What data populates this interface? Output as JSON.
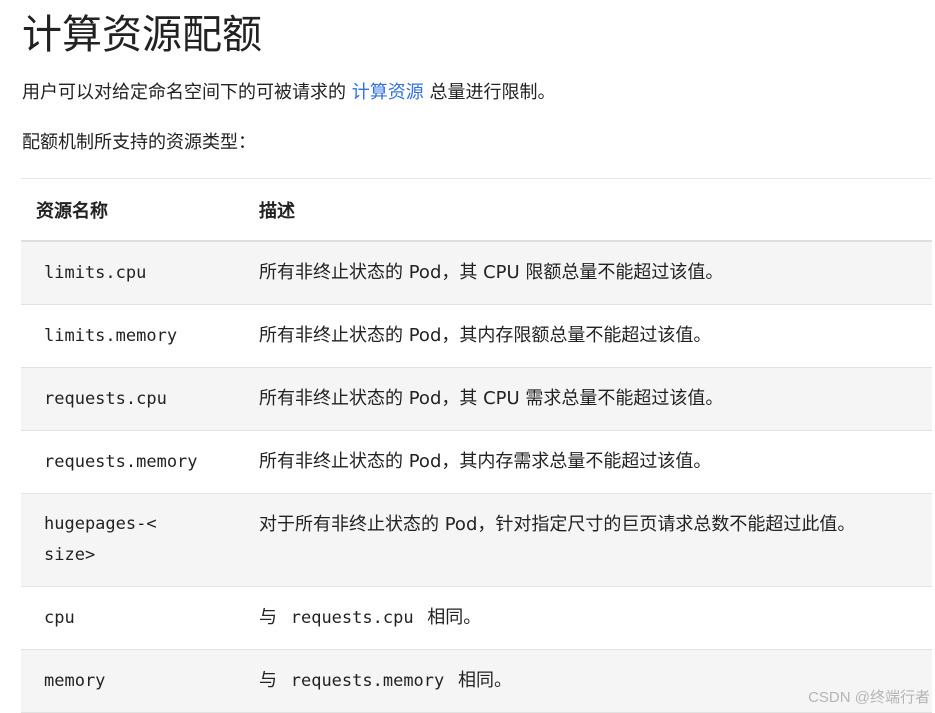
{
  "page": {
    "title": "计算资源配额",
    "intro_before": "用户可以对给定命名空间下的可被请求的 ",
    "intro_link": "计算资源",
    "intro_after": " 总量进行限制。",
    "subintro": "配额机制所支持的资源类型："
  },
  "table": {
    "headers": {
      "name": "资源名称",
      "desc": "描述"
    },
    "rows": [
      {
        "name": "limits.cpu",
        "desc": "所有非终止状态的 Pod，其 CPU 限额总量不能超过该值。"
      },
      {
        "name": "limits.memory",
        "desc": "所有非终止状态的 Pod，其内存限额总量不能超过该值。"
      },
      {
        "name": "requests.cpu",
        "desc": "所有非终止状态的 Pod，其 CPU 需求总量不能超过该值。"
      },
      {
        "name": "requests.memory",
        "desc": "所有非终止状态的 Pod，其内存需求总量不能超过该值。"
      },
      {
        "name": "hugepages-<size>",
        "desc": "对于所有非终止状态的 Pod，针对指定尺寸的巨页请求总数不能超过此值。"
      },
      {
        "name": "cpu",
        "desc_prefix": "与 ",
        "desc_code": "requests.cpu",
        "desc_suffix": " 相同。"
      },
      {
        "name": "memory",
        "desc_prefix": "与 ",
        "desc_code": "requests.memory",
        "desc_suffix": " 相同。"
      }
    ]
  },
  "watermark": "CSDN @终端行者",
  "colors": {
    "link": "#3371e3",
    "row_shade": "#f5f5f5",
    "text": "#222222"
  }
}
